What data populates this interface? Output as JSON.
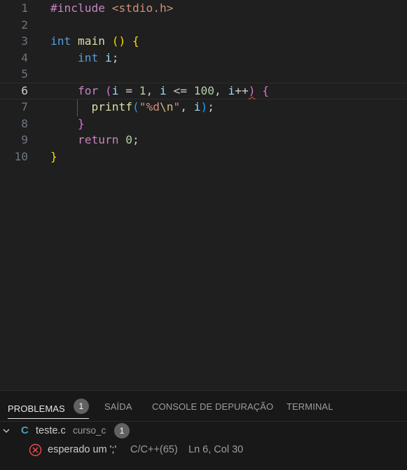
{
  "editor": {
    "lines": [
      {
        "n": "1",
        "tokens": [
          {
            "t": "#include ",
            "c": "t-pre"
          },
          {
            "t": "<stdio.h>",
            "c": "t-inc"
          }
        ]
      },
      {
        "n": "2",
        "tokens": []
      },
      {
        "n": "3",
        "tokens": [
          {
            "t": "int",
            "c": "t-kw"
          },
          {
            "t": " ",
            "c": "t-pl"
          },
          {
            "t": "main",
            "c": "t-fn"
          },
          {
            "t": " ",
            "c": "t-pl"
          },
          {
            "t": "()",
            "c": "t-br1"
          },
          {
            "t": " ",
            "c": "t-pl"
          },
          {
            "t": "{",
            "c": "t-br1"
          }
        ]
      },
      {
        "n": "4",
        "tokens": [
          {
            "t": "    ",
            "c": "t-pl"
          },
          {
            "t": "int",
            "c": "t-kw"
          },
          {
            "t": " ",
            "c": "t-pl"
          },
          {
            "t": "i",
            "c": "t-var"
          },
          {
            "t": ";",
            "c": "t-pl"
          }
        ]
      },
      {
        "n": "5",
        "tokens": []
      },
      {
        "n": "6",
        "current": true,
        "tokens": [
          {
            "t": "    ",
            "c": "t-pl"
          },
          {
            "t": "for",
            "c": "t-ctl"
          },
          {
            "t": " ",
            "c": "t-pl"
          },
          {
            "t": "(",
            "c": "t-br2"
          },
          {
            "t": "i",
            "c": "t-var"
          },
          {
            "t": " = ",
            "c": "t-pl"
          },
          {
            "t": "1",
            "c": "t-num"
          },
          {
            "t": ", ",
            "c": "t-pl"
          },
          {
            "t": "i",
            "c": "t-var"
          },
          {
            "t": " <= ",
            "c": "t-pl"
          },
          {
            "t": "100",
            "c": "t-num"
          },
          {
            "t": ", ",
            "c": "t-pl"
          },
          {
            "t": "i",
            "c": "t-var"
          },
          {
            "t": "++",
            "c": "t-pl"
          },
          {
            "t": ")",
            "c": "t-br2 squiggle"
          },
          {
            "t": " ",
            "c": "t-pl"
          },
          {
            "t": "{",
            "c": "t-br2"
          }
        ]
      },
      {
        "n": "7",
        "tokens": [
          {
            "t": "      ",
            "c": "t-pl"
          },
          {
            "t": "printf",
            "c": "t-fn"
          },
          {
            "t": "(",
            "c": "t-br3"
          },
          {
            "t": "\"%d",
            "c": "t-str"
          },
          {
            "t": "\\n",
            "c": "t-esc"
          },
          {
            "t": "\"",
            "c": "t-str"
          },
          {
            "t": ", ",
            "c": "t-pl"
          },
          {
            "t": "i",
            "c": "t-var"
          },
          {
            "t": ")",
            "c": "t-br3"
          },
          {
            "t": ";",
            "c": "t-pl"
          }
        ]
      },
      {
        "n": "8",
        "tokens": [
          {
            "t": "    ",
            "c": "t-pl"
          },
          {
            "t": "}",
            "c": "t-br2"
          }
        ]
      },
      {
        "n": "9",
        "tokens": [
          {
            "t": "    ",
            "c": "t-pl"
          },
          {
            "t": "return",
            "c": "t-ctl"
          },
          {
            "t": " ",
            "c": "t-pl"
          },
          {
            "t": "0",
            "c": "t-num"
          },
          {
            "t": ";",
            "c": "t-pl"
          }
        ]
      },
      {
        "n": "10",
        "tokens": [
          {
            "t": "}",
            "c": "t-br1"
          }
        ]
      }
    ]
  },
  "panel": {
    "tabs": [
      {
        "label": "PROBLEMAS",
        "badge": "1",
        "active": true
      },
      {
        "label": "SAÍDA"
      },
      {
        "label": "CONSOLE DE DEPURAÇÃO"
      },
      {
        "label": "TERMINAL"
      }
    ],
    "file": {
      "lang_icon": "C",
      "name": "teste.c",
      "folder": "curso_c",
      "count": "1"
    },
    "problem": {
      "message": "esperado um ';'",
      "source": "C/C++(65)",
      "location": "Ln 6, Col 30"
    }
  },
  "colors": {
    "background": "#1f1f1f",
    "panel_background": "#181818",
    "error": "#f14c4c",
    "c_icon": "#519aba"
  },
  "icons": [
    "chevron-down-icon",
    "c-file-icon",
    "error-icon"
  ]
}
